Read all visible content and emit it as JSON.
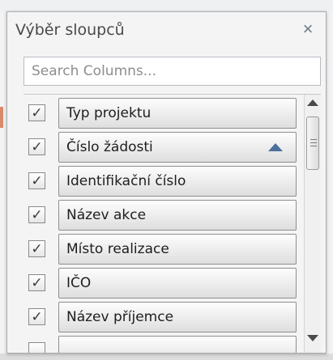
{
  "dialog": {
    "title": "Výběr sloupců",
    "close_icon": "close-icon",
    "close_glyph": "×"
  },
  "search": {
    "placeholder": "Search Columns...",
    "value": ""
  },
  "columns": [
    {
      "label": "Typ projektu",
      "checked": true
    },
    {
      "label": "Číslo žádosti",
      "checked": true,
      "sorted": "ascending"
    },
    {
      "label": "Identifikační číslo",
      "checked": true
    },
    {
      "label": "Název akce",
      "checked": true
    },
    {
      "label": "Místo realizace",
      "checked": true
    },
    {
      "label": "IČO",
      "checked": true
    },
    {
      "label": "Název příjemce",
      "checked": true
    }
  ],
  "check_glyph": "✓",
  "scrollbar": {
    "up_icon": "scroll-up-arrow-icon",
    "down_icon": "scroll-down-arrow-icon"
  }
}
